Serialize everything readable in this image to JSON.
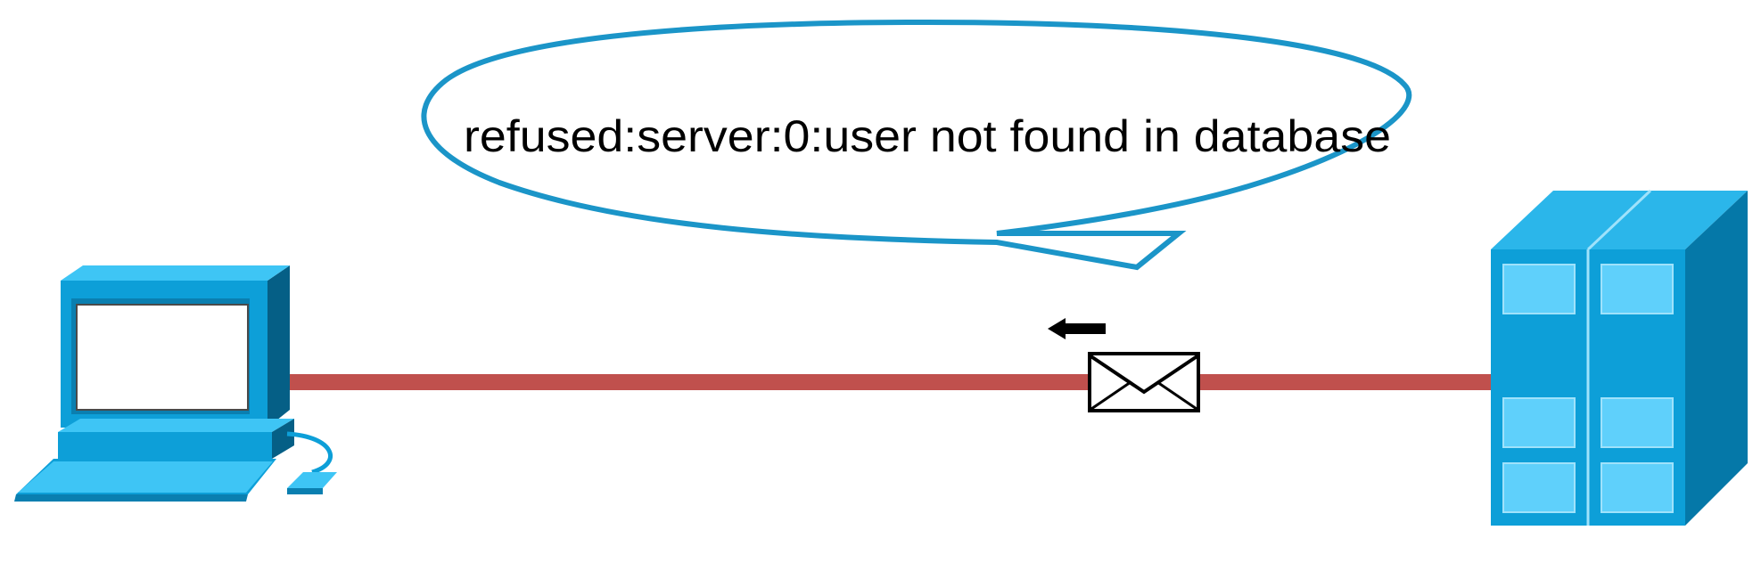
{
  "speech_bubble": {
    "text": "refused:server:0:user not found in database"
  },
  "nodes": {
    "client": {
      "icon": "desktop-computer-icon"
    },
    "server": {
      "icon": "server-tower-icon"
    }
  },
  "link": {
    "message_icon": "envelope-icon",
    "direction_icon": "arrow-left-icon",
    "direction": "server-to-client"
  },
  "colors": {
    "bubble_outline": "#1b95c8",
    "link_line": "#c0504d",
    "device_blue": "#0d9fd8",
    "device_light": "#3ec5f5",
    "device_dark": "#055f86",
    "screen": "#ffffff"
  }
}
